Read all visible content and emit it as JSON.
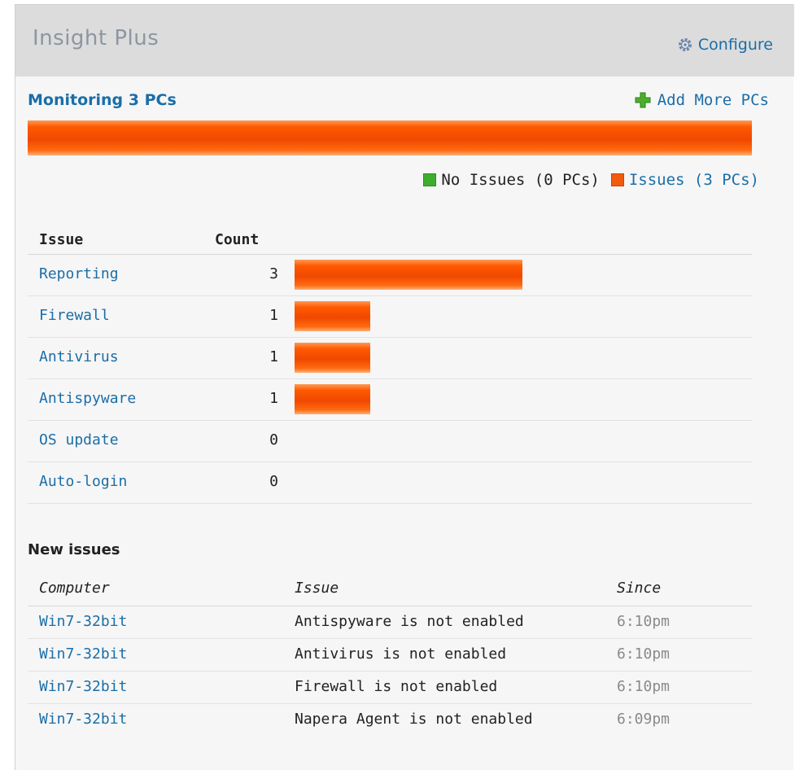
{
  "header": {
    "title": "Insight Plus",
    "configure_label": "Configure"
  },
  "monitoring": {
    "title": "Monitoring 3 PCs",
    "add_more_label": "Add More PCs",
    "issues_fraction": 1.0
  },
  "legend": {
    "no_issues_label": "No Issues (0 PCs)",
    "issues_label": "Issues (3 PCs)",
    "no_issues_color": "#3cae2c",
    "issues_color": "#f25a0e"
  },
  "issues_table": {
    "headers": {
      "issue": "Issue",
      "count": "Count"
    },
    "max_count": 3,
    "rows": [
      {
        "issue": "Reporting",
        "count": "3",
        "value": 3
      },
      {
        "issue": "Firewall",
        "count": "1",
        "value": 1
      },
      {
        "issue": "Antivirus",
        "count": "1",
        "value": 1
      },
      {
        "issue": "Antispyware",
        "count": "1",
        "value": 1
      },
      {
        "issue": "OS update",
        "count": "0",
        "value": 0
      },
      {
        "issue": "Auto-login",
        "count": "0",
        "value": 0
      }
    ]
  },
  "new_issues": {
    "title": "New issues",
    "headers": {
      "computer": "Computer",
      "issue": "Issue",
      "since": "Since"
    },
    "rows": [
      {
        "computer": "Win7-32bit",
        "issue": "Antispyware is not enabled",
        "since": "6:10pm"
      },
      {
        "computer": "Win7-32bit",
        "issue": "Antivirus is not enabled",
        "since": "6:10pm"
      },
      {
        "computer": "Win7-32bit",
        "issue": "Firewall is not enabled",
        "since": "6:10pm"
      },
      {
        "computer": "Win7-32bit",
        "issue": "Napera Agent is not enabled",
        "since": "6:09pm"
      }
    ]
  }
}
